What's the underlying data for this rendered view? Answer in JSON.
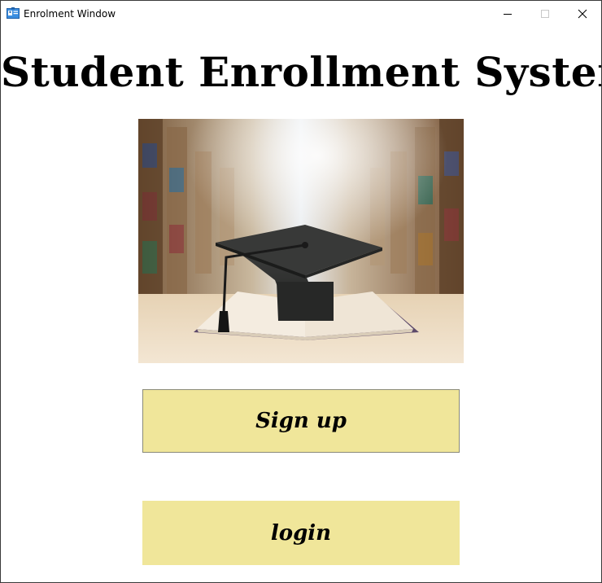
{
  "window": {
    "title": "Enrolment Window"
  },
  "titlebar_icons": {
    "app": "id-card-icon",
    "minimize": "minimize-icon",
    "maximize": "maximize-icon",
    "close": "close-icon"
  },
  "main": {
    "heading": "Student Enrollment System",
    "image": "graduation-cap-on-book-library-photo",
    "signup_label": "Sign up",
    "login_label": "login"
  },
  "colors": {
    "button_bg": "#f0e69a",
    "accent_icon": "#2a7fd4"
  }
}
